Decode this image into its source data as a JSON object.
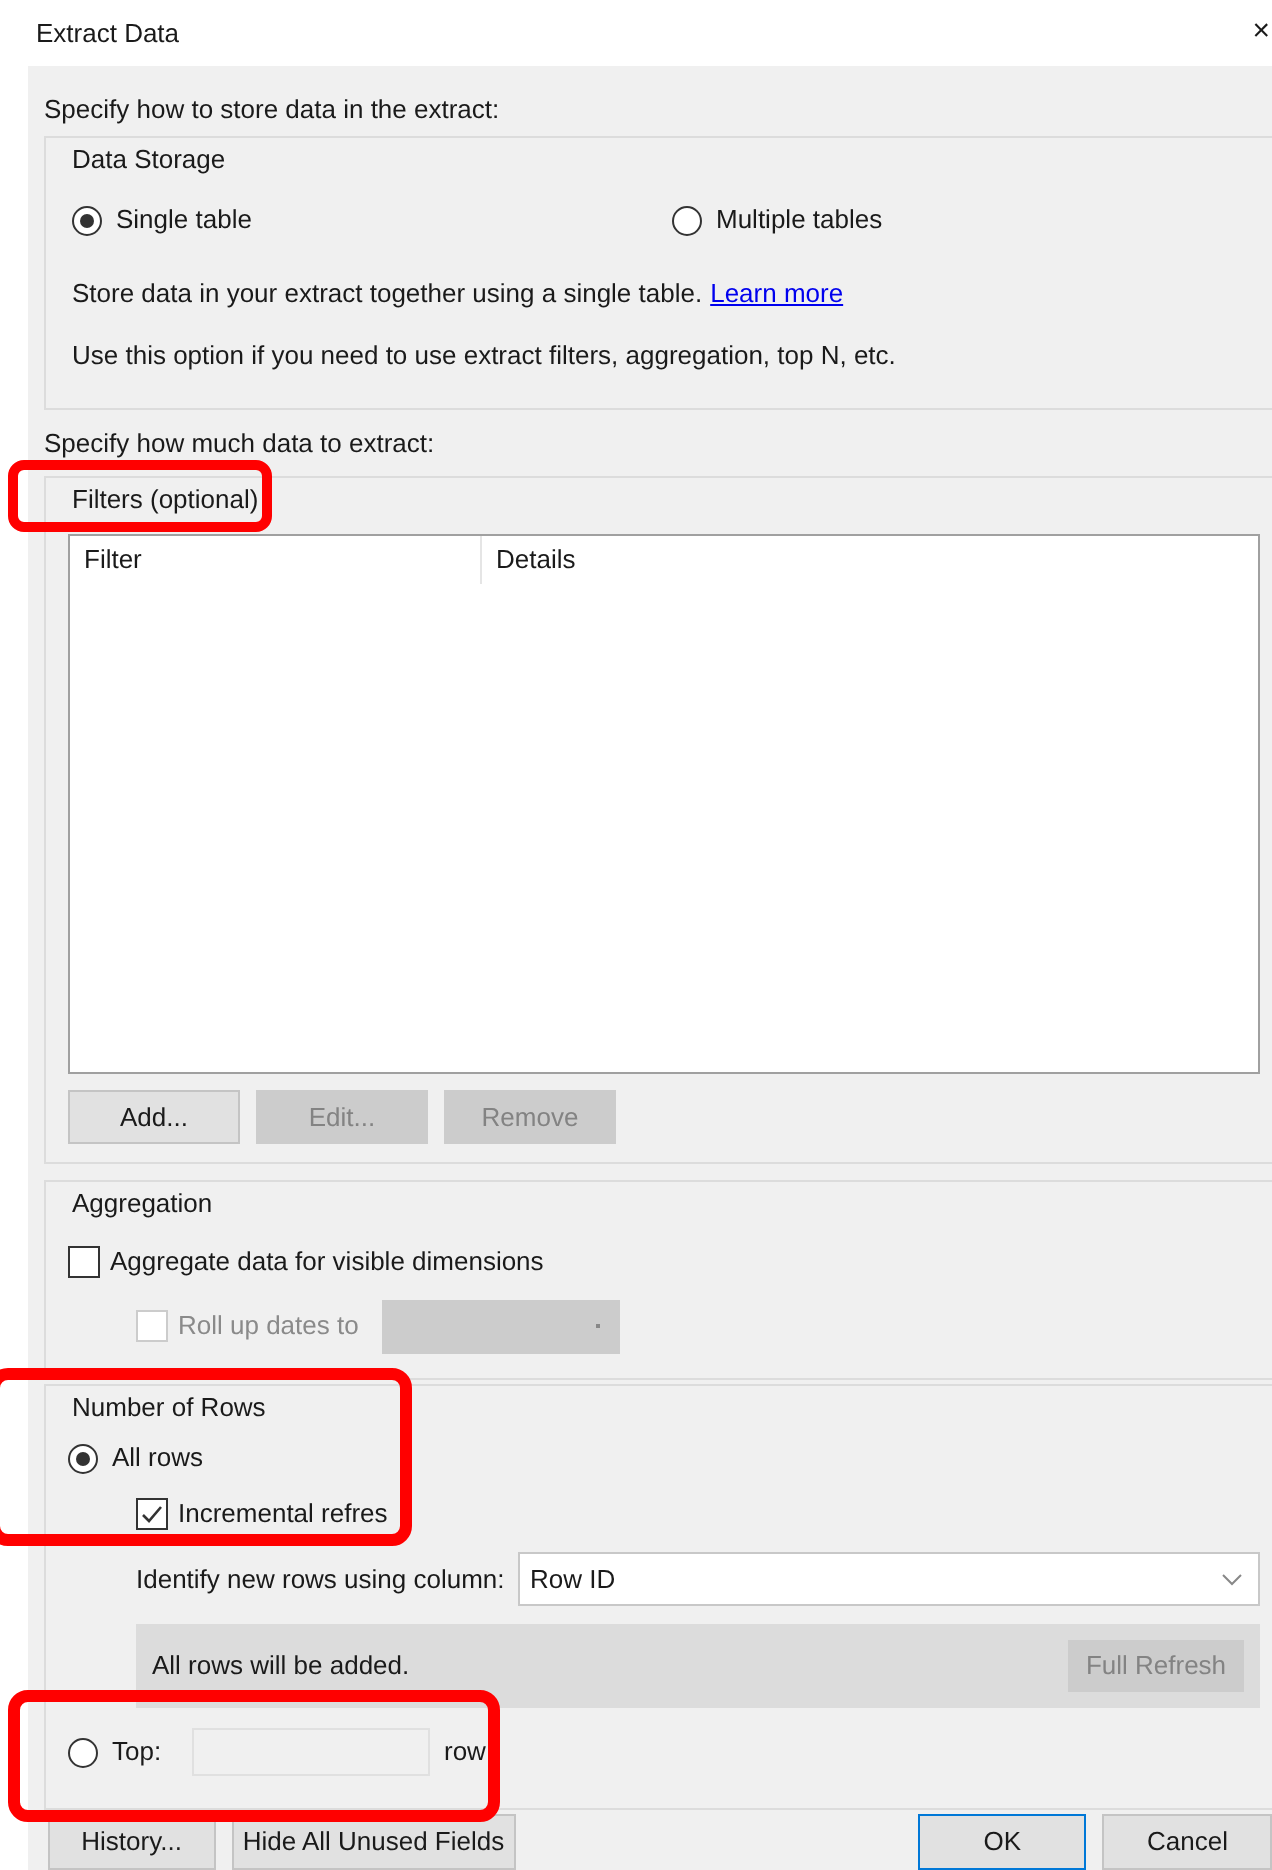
{
  "window": {
    "title": "Extract Data",
    "close": "×"
  },
  "storage_prompt": "Specify how to store data in the extract:",
  "data_storage": {
    "legend": "Data Storage",
    "options": [
      {
        "label": "Single table",
        "selected": true
      },
      {
        "label": "Multiple tables",
        "selected": false
      }
    ],
    "description": "Store data in your extract together using a single table.",
    "link": "Learn more",
    "note": "Use this option if you need to use extract filters, aggregation, top N, etc."
  },
  "extract_prompt": "Specify how much data to extract:",
  "filters": {
    "legend": "Filters (optional)",
    "columns": [
      "Filter",
      "Details"
    ],
    "buttons": [
      {
        "label": "Add...",
        "disabled": false
      },
      {
        "label": "Edit...",
        "disabled": true
      },
      {
        "label": "Remove",
        "disabled": true
      }
    ]
  },
  "aggregation": {
    "legend": "Aggregation",
    "aggregate": {
      "label": "Aggregate data for visible dimensions",
      "checked": false,
      "disabled": false
    },
    "roll_up": {
      "label": "Roll up dates to",
      "checked": false,
      "disabled": true
    }
  },
  "number_of_rows": {
    "legend": "Number of Rows",
    "all_rows": {
      "label": "All rows",
      "selected": true
    },
    "incremental": {
      "label": "Incremental refres",
      "checked": true,
      "disabled": false
    },
    "identify_label": "Identify new rows using column:",
    "column": "Row ID",
    "info": "All rows will be added.",
    "full_refresh": {
      "label": "Full Refresh",
      "disabled": true
    },
    "top": {
      "label": "Top:",
      "selected": false,
      "suffix": "row"
    }
  },
  "footer_buttons": [
    {
      "label": "History...",
      "default": false
    },
    {
      "label": "Hide All Unused Fields",
      "default": false
    },
    {
      "label": "OK",
      "default": true
    },
    {
      "label": "Cancel",
      "default": false
    }
  ]
}
